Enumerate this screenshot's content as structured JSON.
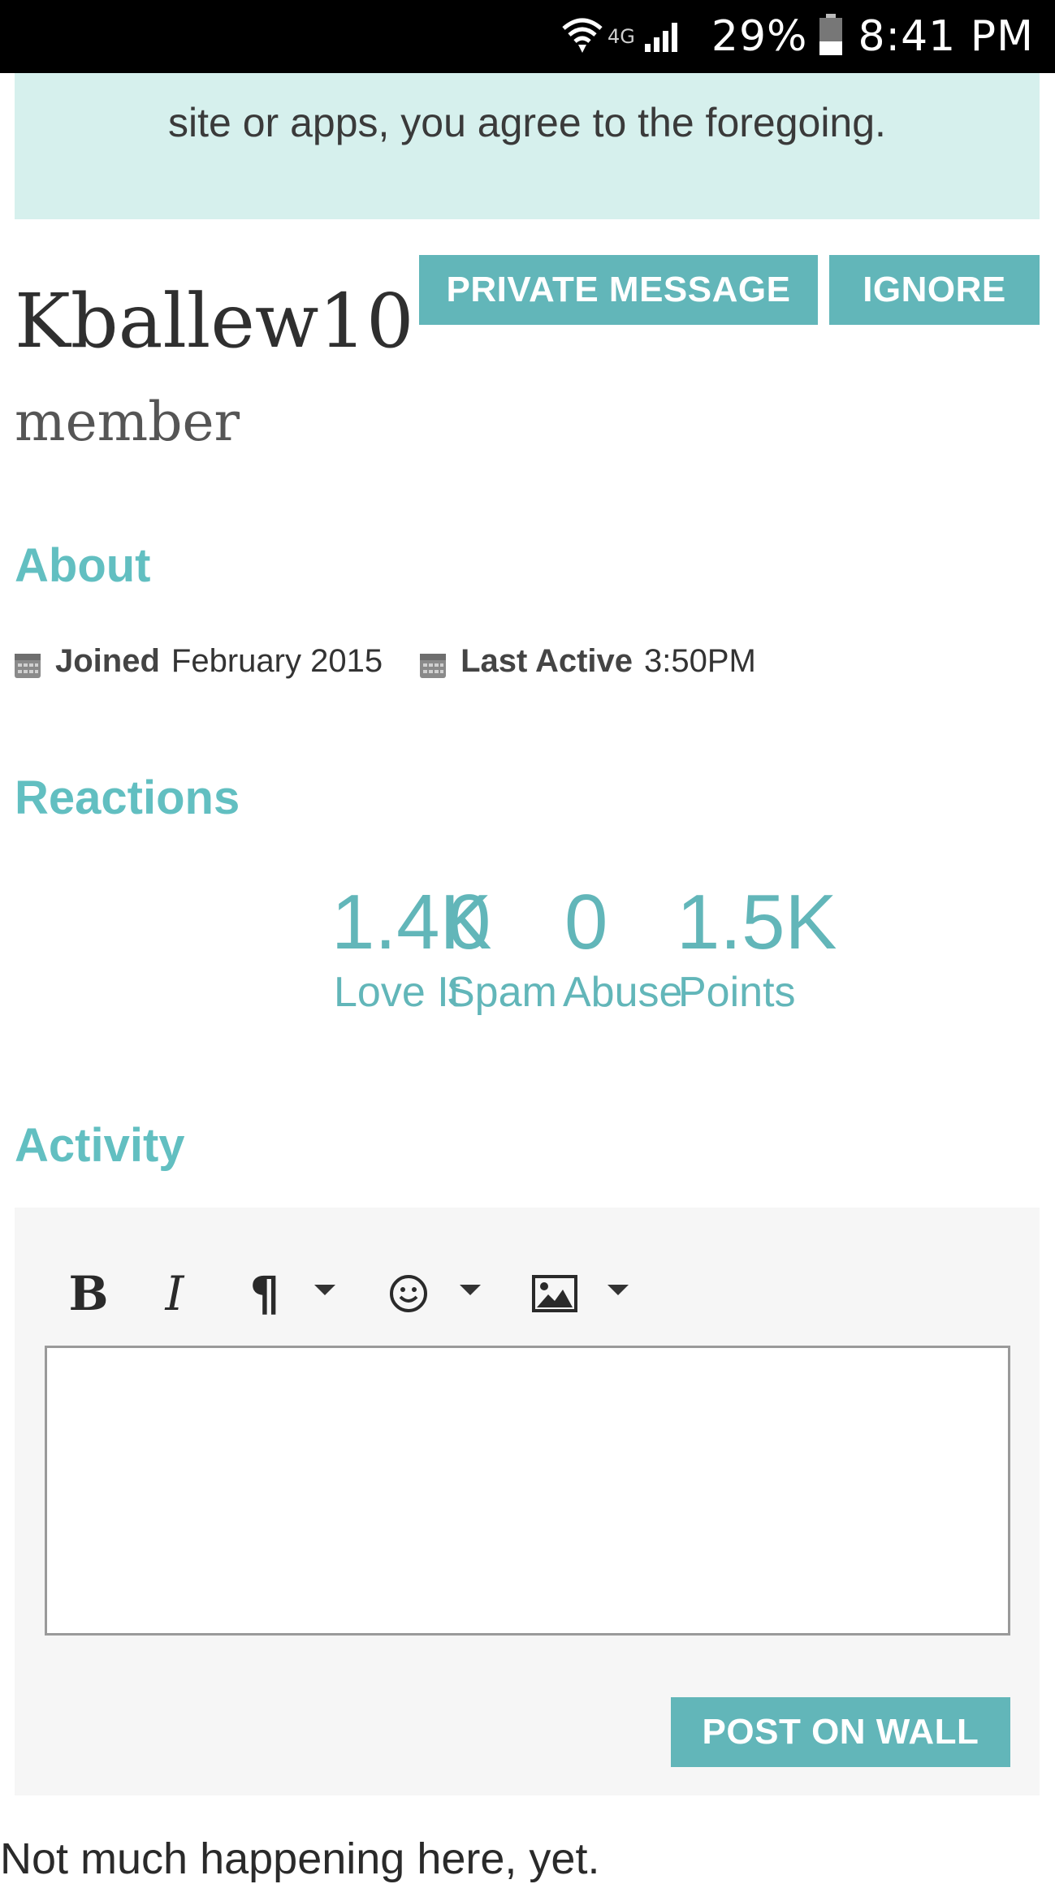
{
  "status_bar": {
    "network": "4G",
    "battery": "29%",
    "time": "8:41 PM"
  },
  "notice": {
    "text": "site or apps, you agree to the foregoing."
  },
  "profile": {
    "username": "Kballew10",
    "role": "member",
    "private_message_label": "PRIVATE MESSAGE",
    "ignore_label": "IGNORE"
  },
  "about": {
    "title": "About",
    "joined_label": "Joined",
    "joined_value": "February 2015",
    "last_active_label": "Last Active",
    "last_active_value": "3:50PM"
  },
  "reactions": {
    "title": "Reactions",
    "stats": [
      {
        "value": "1.4K",
        "label": "Love It"
      },
      {
        "value": "0",
        "label": "Spam"
      },
      {
        "value": "0",
        "label": "Abuse"
      },
      {
        "value": "1.5K",
        "label": "Points"
      }
    ]
  },
  "activity": {
    "title": "Activity",
    "toolbar": {
      "bold": "B",
      "italic": "I",
      "paragraph": "¶"
    },
    "post_label": "POST ON WALL",
    "empty_text": "Not much happening here, yet."
  },
  "icons": {
    "wifi": "wifi-icon",
    "signal": "signal-icon",
    "battery": "battery-icon",
    "calendar": "calendar-icon",
    "emoji": "smiley-icon",
    "image": "image-icon"
  },
  "colors": {
    "accent": "#62b6b9",
    "heading": "#62bfc1",
    "notice_bg": "#d6f0ed"
  }
}
